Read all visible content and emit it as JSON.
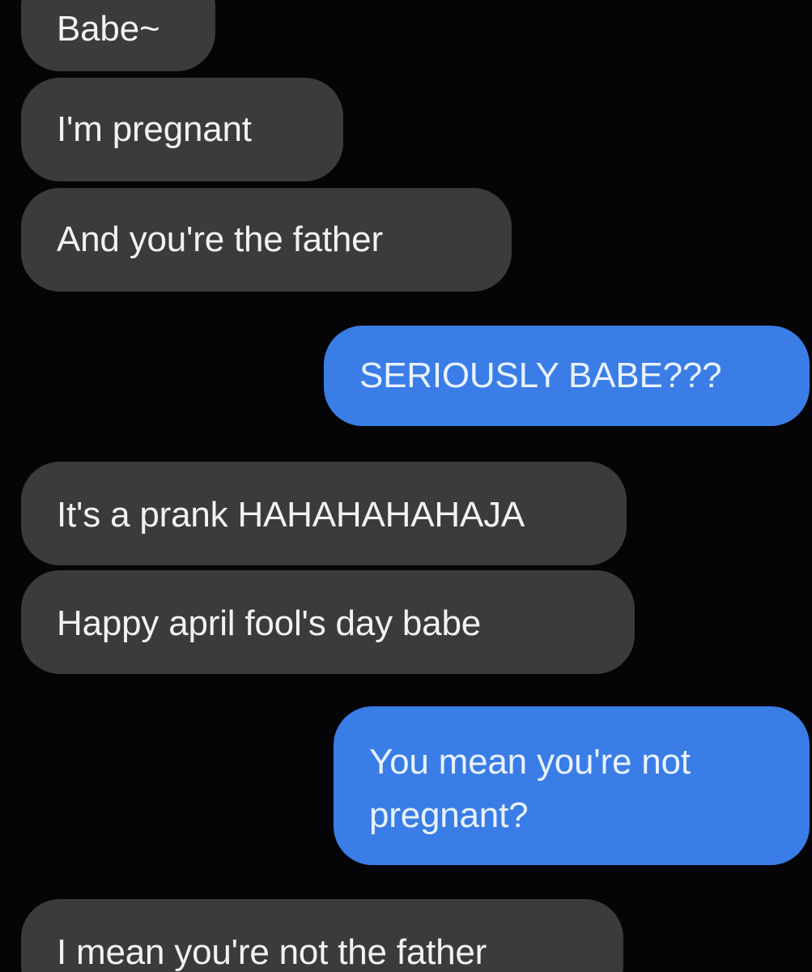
{
  "conversation": {
    "messages": [
      {
        "sender": "them",
        "text": "Babe~"
      },
      {
        "sender": "them",
        "text": "I'm pregnant"
      },
      {
        "sender": "them",
        "text": "And you're the father"
      },
      {
        "sender": "me",
        "text": "SERIOUSLY BABE???"
      },
      {
        "sender": "them",
        "text": "It's a prank HAHAHAHAHAJA"
      },
      {
        "sender": "them",
        "text": "Happy april fool's day babe"
      },
      {
        "sender": "me",
        "text": "You mean you're not pregnant?"
      },
      {
        "sender": "them",
        "text": "I mean you're not the father"
      }
    ]
  },
  "colors": {
    "background": "#050507",
    "incoming_bubble": "#3b3b3d",
    "outgoing_bubble": "#3a7de6",
    "incoming_text": "#f2f2f2",
    "outgoing_text": "#e9f2ff"
  }
}
